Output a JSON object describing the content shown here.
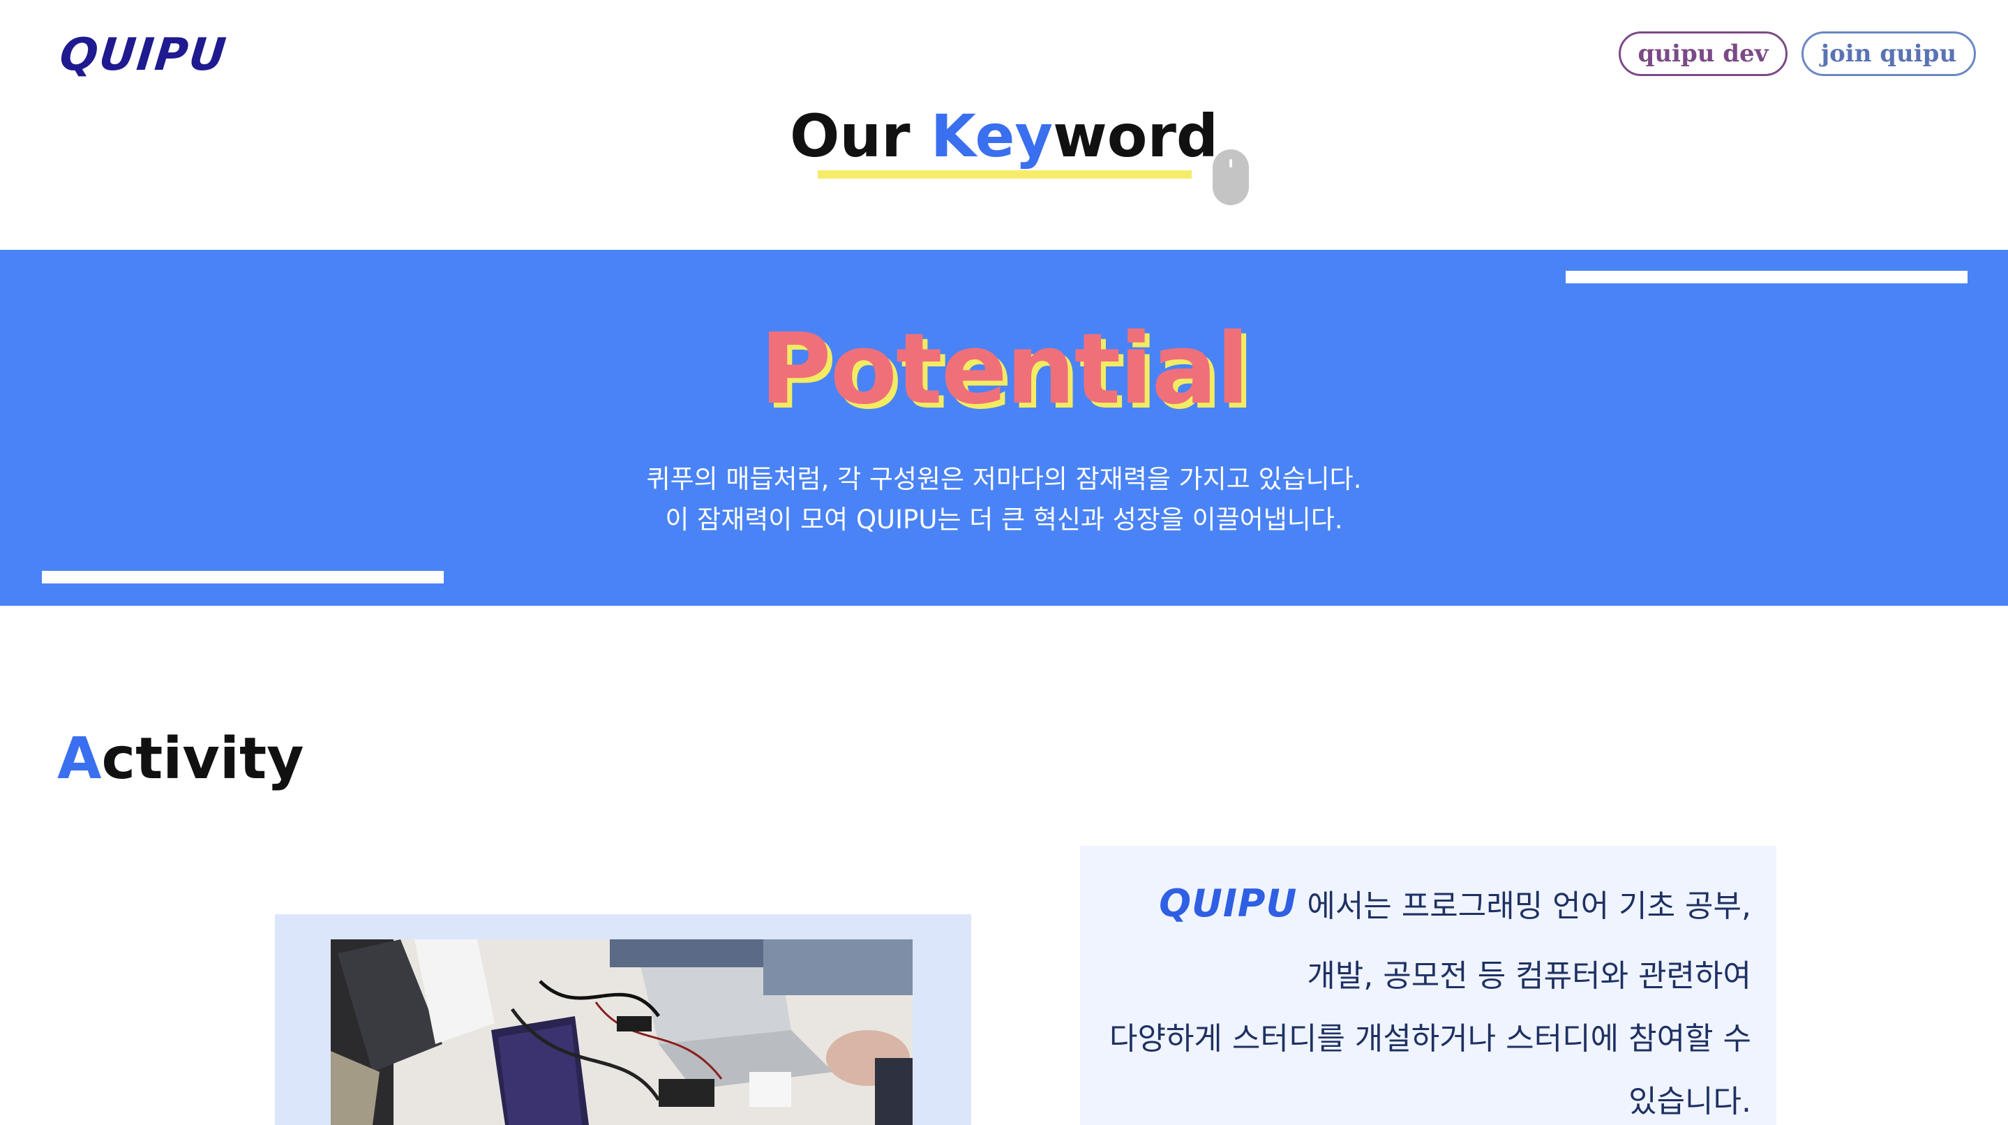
{
  "header": {
    "logo": "QUIPU",
    "nav": {
      "dev_label": "quipu dev",
      "join_label": "join quipu"
    }
  },
  "keyword_section": {
    "title_prefix": "Our ",
    "title_accent": "Key",
    "title_suffix": "word"
  },
  "potential_band": {
    "heading": "Potential",
    "line1": "퀴푸의 매듭처럼, 각 구성원은 저마다의 잠재력을 가지고 있습니다.",
    "line2": "이 잠재력이 모여 QUIPU는 더 큰 혁신과 성장을 이끌어냅니다.",
    "colors": {
      "band": "#4a83f5",
      "heading": "#f0707a",
      "shadow": "#f2ec62"
    }
  },
  "activity": {
    "title_accent": "A",
    "title_rest": "ctivity",
    "brand": "QUIPU",
    "line1": "에서는 프로그래밍 언어 기초 공부,",
    "line2": "개발, 공모전 등 컴퓨터와 관련하여",
    "line3": "다양하게 스터디를 개설하거나 스터디에 참여할 수",
    "line4": "있습니다."
  },
  "icons": [
    "mouse-scroll-icon"
  ]
}
